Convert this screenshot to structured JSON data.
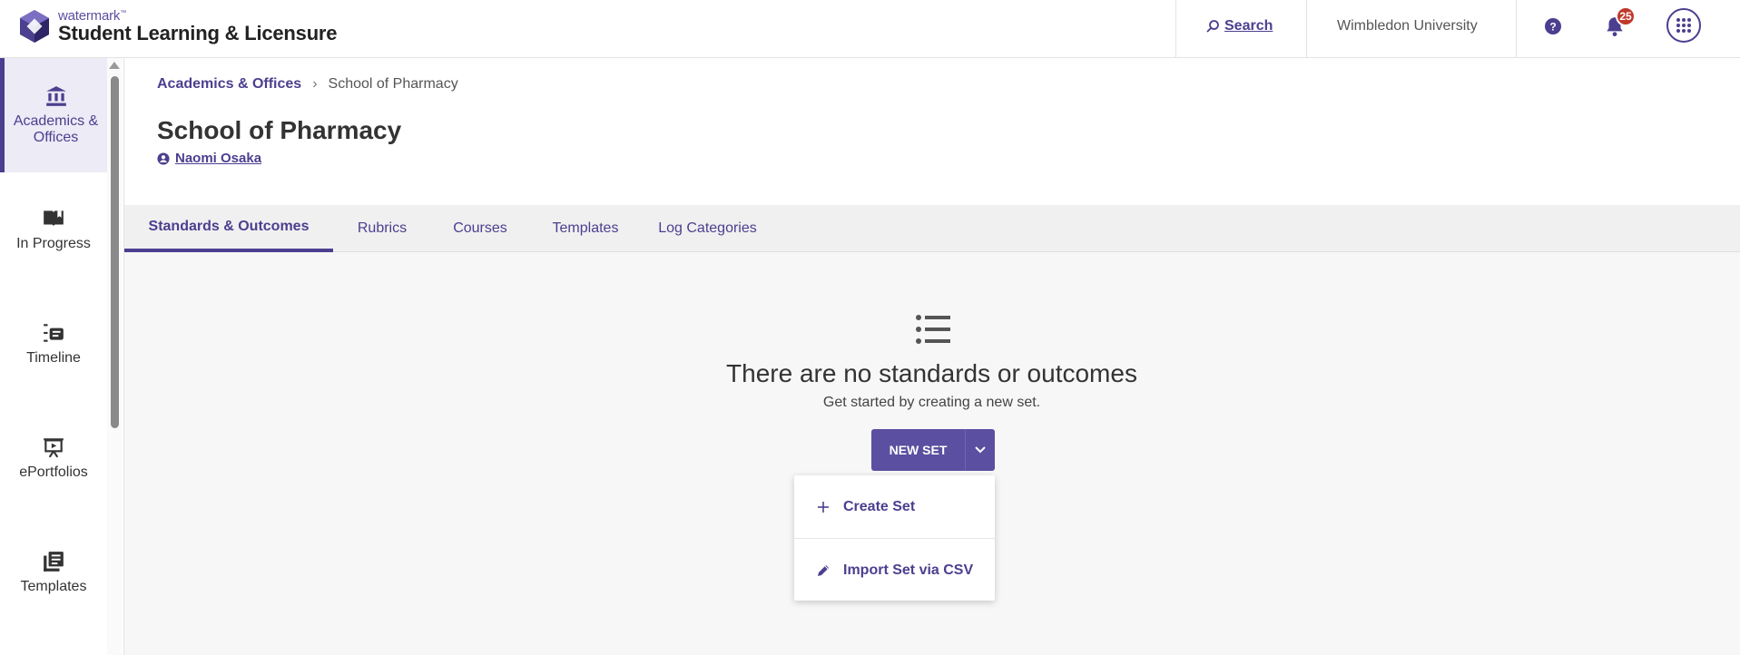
{
  "header": {
    "brand": "watermark",
    "brand_tm": "™",
    "product": "Student Learning & Licensure",
    "search_label": "Search",
    "university": "Wimbledon University",
    "notification_count": "25",
    "accent_color": "#4b3f8f",
    "badge_color": "#c0392b"
  },
  "sidebar": {
    "items": [
      {
        "label": "Academics & Offices",
        "icon": "bank-icon",
        "active": true
      },
      {
        "label": "In Progress",
        "icon": "book-icon",
        "active": false
      },
      {
        "label": "Timeline",
        "icon": "timeline-icon",
        "active": false
      },
      {
        "label": "ePortfolios",
        "icon": "presentation-icon",
        "active": false
      },
      {
        "label": "Templates",
        "icon": "templates-icon",
        "active": false
      }
    ]
  },
  "breadcrumb": {
    "parent": "Academics & Offices",
    "separator": "›",
    "current": "School of Pharmacy"
  },
  "page": {
    "title": "School of Pharmacy",
    "owner": "Naomi Osaka"
  },
  "tabs": [
    {
      "label": "Standards & Outcomes",
      "active": true
    },
    {
      "label": "Rubrics",
      "active": false
    },
    {
      "label": "Courses",
      "active": false
    },
    {
      "label": "Templates",
      "active": false
    },
    {
      "label": "Log Categories",
      "active": false
    }
  ],
  "empty_state": {
    "icon": "list-icon",
    "title": "There are no standards or outcomes",
    "subtitle": "Get started by creating a new set."
  },
  "new_set_button": {
    "label": "NEW SET"
  },
  "dropdown": {
    "items": [
      {
        "label": "Create Set",
        "icon": "plus-icon"
      },
      {
        "label": "Import Set via CSV",
        "icon": "pencil-icon"
      }
    ]
  }
}
